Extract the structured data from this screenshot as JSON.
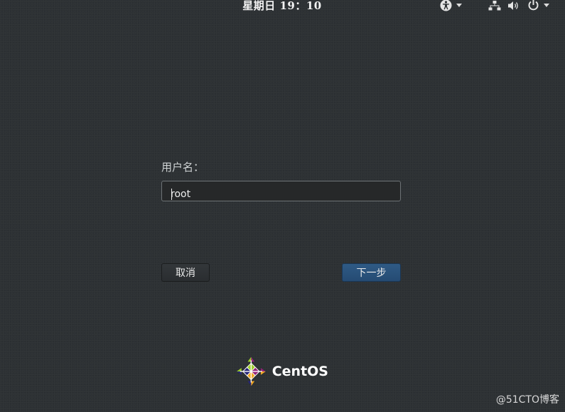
{
  "topbar": {
    "clock": "星期日 19：10",
    "icons": [
      "accessibility-icon",
      "network-icon",
      "volume-icon",
      "power-icon"
    ]
  },
  "login": {
    "username_label": "用户名：",
    "username_value": "root",
    "cancel_label": "取消",
    "next_label": "下一步"
  },
  "branding": {
    "logo_text": "CentOS"
  },
  "watermark": "@51CTO博客",
  "colors": {
    "background": "#2d3134",
    "primary_button": "#2a5380",
    "input_bg": "#262829"
  }
}
